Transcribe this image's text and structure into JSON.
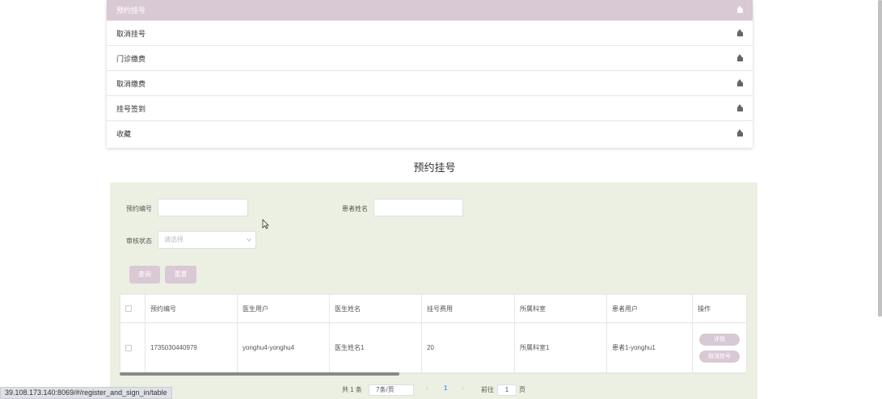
{
  "menu": {
    "items": [
      {
        "label": "预约挂号",
        "active": true
      },
      {
        "label": "取消挂号",
        "active": false
      },
      {
        "label": "门诊缴费",
        "active": false
      },
      {
        "label": "取消缴费",
        "active": false
      },
      {
        "label": "挂号签到",
        "active": false
      },
      {
        "label": "收藏",
        "active": false
      }
    ],
    "icon": "home-icon"
  },
  "page_title": "预约挂号",
  "search": {
    "booking_no_label": "预约编号",
    "booking_no_value": "",
    "patient_name_label": "患者姓名",
    "patient_name_value": "",
    "status_label": "审核状态",
    "status_placeholder": "请选择",
    "query_label": "查询",
    "reset_label": "重置"
  },
  "table": {
    "headers": [
      "预约编号",
      "医生用户",
      "医生姓名",
      "挂号费用",
      "所属科室",
      "患者用户",
      "操作"
    ],
    "rows": [
      {
        "booking_no": "1735030440979",
        "doctor_user": "yonghu4-yonghu4",
        "doctor_name": "医生姓名1",
        "fee": "20",
        "department": "所属科室1",
        "patient_user": "患者1-yonghu1",
        "actions": [
          "详情",
          "取消挂号"
        ]
      }
    ]
  },
  "pagination": {
    "total": "共 1 条",
    "page_size": "7条/页",
    "current_page": "1",
    "goto_label": "前往",
    "goto_value": "1",
    "page_suffix": "页"
  },
  "status_bar_url": "39.108.173.140:8069/#/register_and_sign_in/table",
  "colors": {
    "accent": "#d9c9d4",
    "panel_bg": "#ebf0e2"
  }
}
